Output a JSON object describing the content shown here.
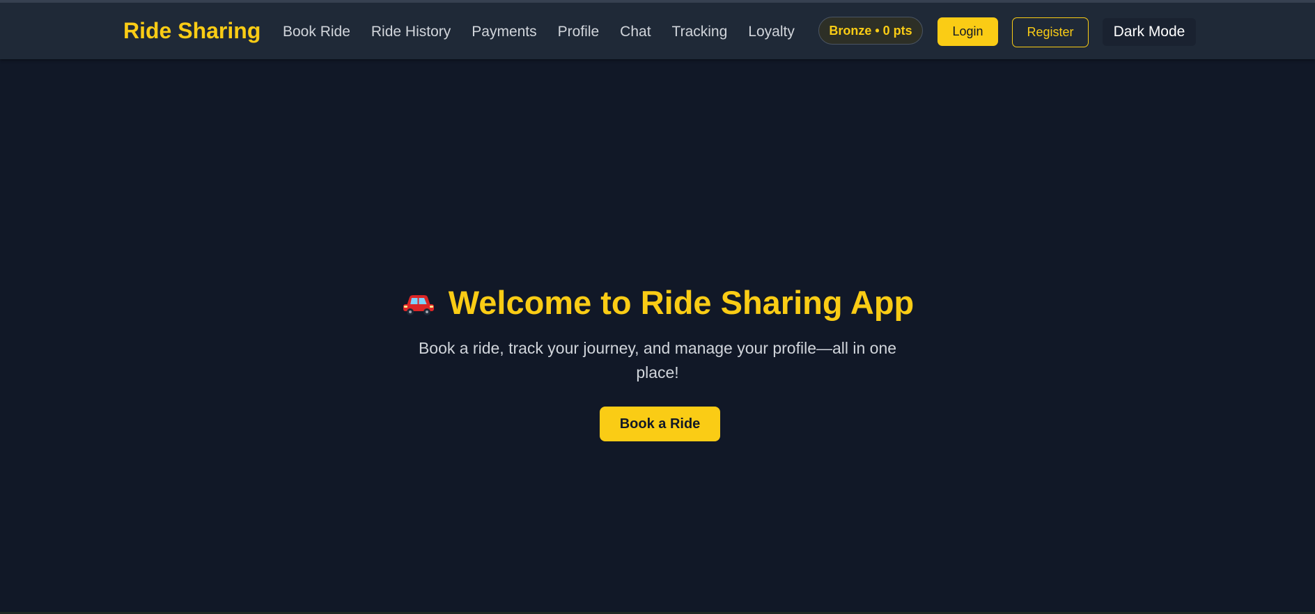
{
  "navbar": {
    "brand": "Ride Sharing",
    "links": [
      "Book Ride",
      "Ride History",
      "Payments",
      "Profile",
      "Chat",
      "Tracking",
      "Loyalty"
    ],
    "loyalty_badge": "Bronze • 0 pts",
    "login_label": "Login",
    "register_label": "Register",
    "theme_toggle_label": "Dark Mode"
  },
  "hero": {
    "icon": "car-icon",
    "title": "Welcome to Ride Sharing App",
    "subtitle": "Book a ride, track your journey, and manage your profile—all in one place!",
    "cta_label": "Book a Ride"
  },
  "colors": {
    "accent": "#facc15",
    "background": "#111827",
    "navbar": "#1f2937",
    "text_muted": "#d1d5db"
  }
}
